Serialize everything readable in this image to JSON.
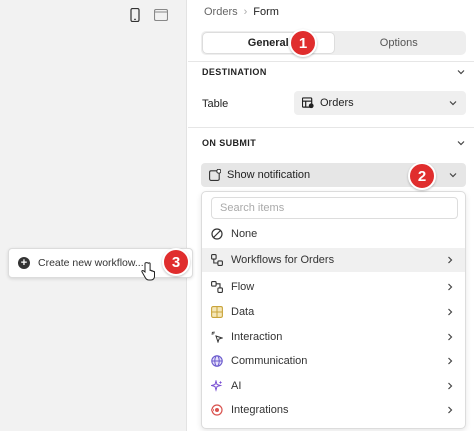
{
  "breadcrumb": {
    "parent": "Orders",
    "separator": "›",
    "current": "Form"
  },
  "tabs": [
    {
      "label": "General",
      "active": true
    },
    {
      "label": "Options",
      "active": false
    }
  ],
  "destination": {
    "heading": "DESTINATION",
    "table_label": "Table",
    "table_value": "Orders"
  },
  "on_submit": {
    "heading": "ON SUBMIT",
    "action_value": "Show notification"
  },
  "dropdown": {
    "search_placeholder": "Search items",
    "items": [
      {
        "label": "None",
        "icon": "none-icon",
        "has_submenu": false
      },
      {
        "label": "Workflows for Orders",
        "icon": "workflow-icon",
        "has_submenu": true,
        "hovered": true
      },
      {
        "label": "Flow",
        "icon": "flow-icon",
        "has_submenu": true
      },
      {
        "label": "Data",
        "icon": "data-grid-icon",
        "has_submenu": true
      },
      {
        "label": "Interaction",
        "icon": "interaction-cursor-icon",
        "has_submenu": true
      },
      {
        "label": "Communication",
        "icon": "globe-icon",
        "has_submenu": true
      },
      {
        "label": "AI",
        "icon": "sparkle-icon",
        "has_submenu": true
      },
      {
        "label": "Integrations",
        "icon": "integrations-icon",
        "has_submenu": true
      }
    ]
  },
  "workflow_popup": {
    "label": "Create new workflow..."
  },
  "badges": {
    "one": "1",
    "two": "2",
    "three": "3"
  },
  "colors": {
    "badge": "#e02d2d",
    "data_icon": "#c9a43a",
    "globe_icon": "#6a5acd",
    "ai_icon": "#7a4fd3",
    "integrations_icon": "#d9534f"
  }
}
